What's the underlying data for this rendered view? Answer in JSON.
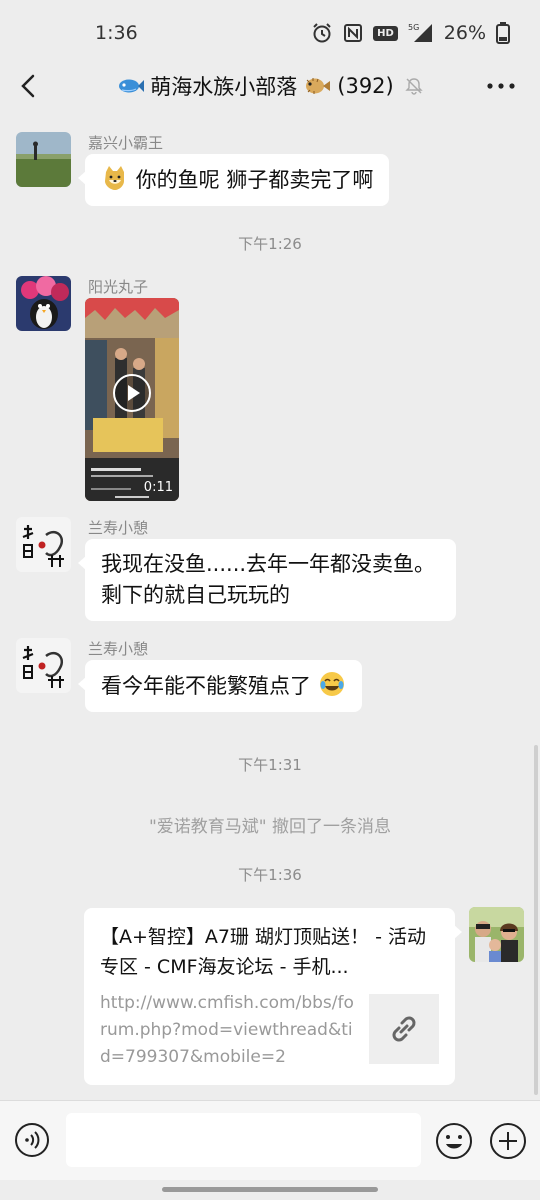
{
  "status": {
    "time": "1:36",
    "battery": "26%",
    "network": "5G"
  },
  "header": {
    "title": "萌海水族小部落",
    "member_count": "(392)"
  },
  "messages": [
    {
      "sender": "嘉兴小霸王",
      "text": "你的鱼呢  狮子都卖完了啊"
    },
    {
      "time": "下午1:26"
    },
    {
      "sender": "阳光丸子",
      "video_duration": "0:11"
    },
    {
      "sender": "兰寿小憩",
      "text_line1": "我现在没鱼......去年一年都没卖鱼。",
      "text_line2": "剩下的就自己玩玩的"
    },
    {
      "sender": "兰寿小憩",
      "text": "看今年能不能繁殖点了"
    },
    {
      "time": "下午1:31"
    },
    {
      "notice": "\"爱诺教育马斌\" 撤回了一条消息"
    },
    {
      "time": "下午1:36"
    }
  ],
  "link_card": {
    "title": "【A+智控】A7珊 瑚灯顶贴送！ - 活动专区 - CMF海友论坛 - 手机...",
    "url": "http://www.cmfish.com/bbs/forum.php?mod=viewthread&tid=799307&mobile=2"
  },
  "input": {
    "placeholder": ""
  },
  "colors": {
    "background": "#ededed",
    "bubble": "#ffffff",
    "time_text": "#8c8c8c"
  },
  "icons": [
    "back-arrow-icon",
    "more-dots-icon",
    "fish-icon",
    "pufferfish-icon",
    "mute-bell-icon",
    "play-icon",
    "link-icon",
    "voice-icon",
    "emoji-icon",
    "plus-icon",
    "alarm-icon",
    "nfc-icon",
    "battery-icon"
  ]
}
